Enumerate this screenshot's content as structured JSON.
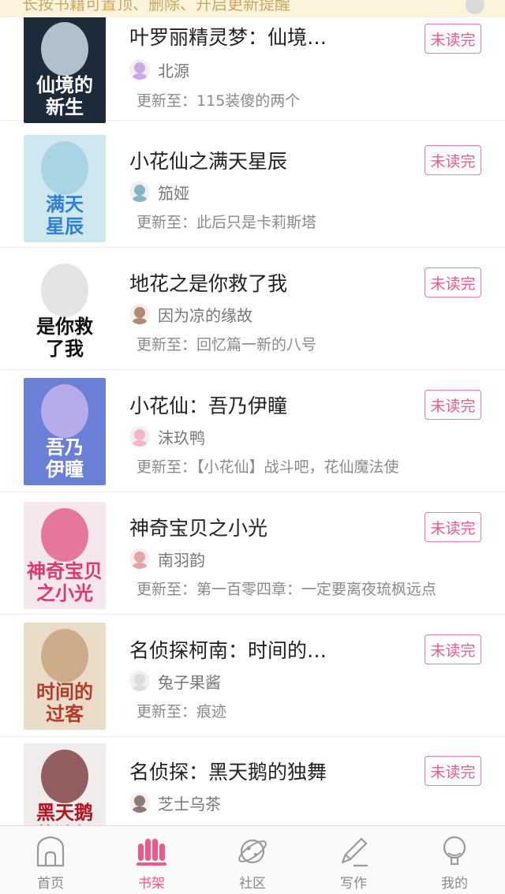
{
  "tip": {
    "text": "长按书籍可置顶、删除、开启更新提醒"
  },
  "books": [
    {
      "title": "叶罗丽精灵梦：仙境…",
      "author": "北源",
      "update_label": "更新至：",
      "update_text": "115装傻的两个",
      "badge": "未读完",
      "cover_icon": "book-cover",
      "avatar_icon": "author-avatar"
    },
    {
      "title": "小花仙之满天星辰",
      "author": "笳娅",
      "update_label": "更新至：",
      "update_text": "此后只是卡莉斯塔",
      "badge": "未读完",
      "cover_icon": "book-cover",
      "avatar_icon": "author-avatar"
    },
    {
      "title": "地花之是你救了我",
      "author": "因为凉的缘故",
      "update_label": "更新至：",
      "update_text": "回忆篇一新的八号",
      "badge": "未读完",
      "cover_icon": "book-cover",
      "avatar_icon": "author-avatar"
    },
    {
      "title": "小花仙：吾乃伊瞳",
      "author": "沫玖鸭",
      "update_label": "更新至：",
      "update_text": "【小花仙】战斗吧，花仙魔法使",
      "badge": "未读完",
      "cover_icon": "book-cover",
      "avatar_icon": "author-avatar"
    },
    {
      "title": "神奇宝贝之小光",
      "author": "南羽韵",
      "update_label": "更新至：",
      "update_text": "第一百零四章：一定要离夜琉枫远点",
      "badge": "未读完",
      "cover_icon": "book-cover",
      "avatar_icon": "author-avatar"
    },
    {
      "title": "名侦探柯南：时间的…",
      "author": "兔子果酱",
      "update_label": "更新至：",
      "update_text": "痕迹",
      "badge": "未读完",
      "cover_icon": "book-cover",
      "avatar_icon": "author-avatar"
    },
    {
      "title": "名侦探：黑天鹅的独舞",
      "author": "芝士乌茶",
      "update_label": "",
      "update_text": "",
      "badge": "未读完",
      "cover_icon": "book-cover",
      "avatar_icon": "author-avatar"
    }
  ],
  "covers": [
    {
      "text": "仙境的新生",
      "bg": "#1d2a3a",
      "accent": "#d8e6f2",
      "text_color": "#ffffff"
    },
    {
      "text": "满天星辰",
      "bg": "#cfe7ef",
      "accent": "#9fd0e0",
      "text_color": "#2f7fd6"
    },
    {
      "text": "是你救了我",
      "bg": "#ffffff",
      "accent": "#dddddd",
      "text_color": "#111111"
    },
    {
      "text": "吾乃伊瞳",
      "bg": "#6a7fd6",
      "accent": "#c9b7f0",
      "text_color": "#ffffff"
    },
    {
      "text": "神奇宝贝之小光",
      "bg": "#f6e7ee",
      "accent": "#e45a86",
      "text_color": "#e0386e"
    },
    {
      "text": "时间的过客",
      "bg": "#e9dcc9",
      "accent": "#c6a07a",
      "text_color": "#b63a2a"
    },
    {
      "text": "黑天鹅的独舞",
      "bg": "#f1ecec",
      "accent": "#7a3b3b",
      "text_color": "#b3121e"
    }
  ],
  "avatar_colors": [
    "#c9a9e8",
    "#86b5c9",
    "#b08a72",
    "#f2b6c8",
    "#e6a4a4",
    "#dddddd",
    "#8c7a74"
  ],
  "tabbar": {
    "items": [
      {
        "label": "首页",
        "icon": "home-icon",
        "active": false
      },
      {
        "label": "书架",
        "icon": "bookshelf-icon",
        "active": true
      },
      {
        "label": "社区",
        "icon": "planet-icon",
        "active": false
      },
      {
        "label": "写作",
        "icon": "pen-icon",
        "active": false
      },
      {
        "label": "我的",
        "icon": "profile-icon",
        "active": false
      }
    ]
  },
  "colors": {
    "accent": "#f0588a",
    "tip_bg": "#fdf3dc",
    "tip_text": "#c9a85f"
  }
}
